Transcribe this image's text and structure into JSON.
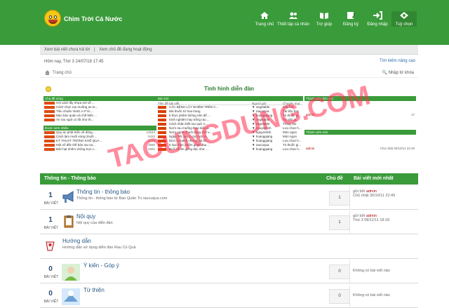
{
  "brand": {
    "title": "Chim Trời Cá Nước"
  },
  "nav": [
    {
      "label": "Trang chủ",
      "icon": "home-icon"
    },
    {
      "label": "Thiết lập cá nhân",
      "icon": "users-icon"
    },
    {
      "label": "Trợ giúp",
      "icon": "book-icon"
    },
    {
      "label": "Đăng ký",
      "icon": "register-icon"
    },
    {
      "label": "Đăng nhập",
      "icon": "login-icon"
    },
    {
      "label": "Tuỳ chọn",
      "icon": "settings-icon"
    }
  ],
  "subbar": {
    "unanswered": "Xem bài viết chưa trả lời",
    "separator": "|",
    "active": "Xem chủ đề đang hoạt động"
  },
  "meta": {
    "date": "Hôm nay, Thứ 3 24/07/18 17:45",
    "advanced_search": "Tìm kiếm nâng cao",
    "home_crumb": "Trang chủ",
    "search_placeholder": "Nhập từ khóa"
  },
  "stats": {
    "title": "Tình hình diễn đàn",
    "recent_topics": {
      "header": "Chủ đề nóng",
      "items": [
        "Hỏi cách lấy nhựa mít về ...",
        "Cách chọn rau muống an to...",
        "Tiêu chuẩn VietG.A.P là ...",
        "Mẹo bảo quản và chế biến ...",
        "Ăn rau ngót có tốt như th..."
      ]
    },
    "viewed": {
      "header": "Được xem nhiều",
      "items": [
        {
          "text": "Quy an phát triển về động ...",
          "num": "13534"
        },
        {
          "text": "Cách làm muối vùng (muối ...",
          "num": "5433"
        },
        {
          "text": "KỸ THUẬT TRỒNG KHỔ QUA ...",
          "num": "3724"
        },
        {
          "text": "Một số đất chế bán rau sa...",
          "num": "3580"
        },
        {
          "text": "Bán hạt nhồm xhông trọn c...",
          "num": "2692"
        }
      ]
    },
    "new_posts": {
      "header": "Bài mới",
      "sub": "Tiêu đề bài viết",
      "items": [
        "CÁC BỆNH LÂY NHIỄM TRÊN C...",
        "Bài thuốc từ hoa trang",
        "6 thực phẩm không nên để ...",
        "Kinh nghiệm hay trồng rau ...",
        "Cách nhận biết rau quả 'o...",
        "Nơm rau muống theo kiểu d...",
        "Nơm ngứa chuối dùng chữ v...",
        "Ngày Tết, lưu ý các món ả...",
        "Dịch vụ bánh chưng, cá kh...",
        "5 loại thực phẩm giảm đau...",
        "Buổi tối ăn gừng độc như ..."
      ]
    },
    "posters": {
      "header": "Người gửi",
      "items": [
        "vegetable",
        "raucuqua",
        "hoanggiang",
        "vegetable",
        "vegetable",
        "nguyenlinh",
        "nguyenlinh",
        "hoanggiang",
        "hoanggiang",
        "raucuqua",
        "hoanggiang"
      ]
    },
    "forums": {
      "header": "Chuyên mục",
      "items": [
        "Cây lúa",
        "Tài liệu hay",
        "Tủ thuốc gi...",
        "Tư vấn gi...",
        "Trồng rau",
        "Lưu chọn h...",
        "Món ngon",
        "Món ngon",
        "Lưu chọn h...",
        "Tủ thuốc gi...",
        "Lưu chọn h..."
      ]
    },
    "active_members": {
      "header": "Thành viên tích cực",
      "name": "admin",
      "count": "17"
    },
    "new_members": {
      "header": "Thành viên mới",
      "name": "admin",
      "date": "Chủ nhật 30/10/11 22:49"
    }
  },
  "watermark": "TAOUNGDUNG.COM",
  "forum": {
    "header": {
      "title": "Thông tin - Thông báo",
      "topics": "Chủ đề",
      "latest": "Bài viết mới nhất"
    },
    "rows": [
      {
        "count": "1",
        "count_label": "BÀI VIẾT",
        "title": "Thông tin - thông báo",
        "desc": "Thông tin - thông báo từ Ban Quản Trị raucuqua.com",
        "topic_count": "1",
        "latest_prefix": "gửi bởi",
        "latest_author": "admin",
        "latest_date": "Chủ nhật 30/10/11 22:49",
        "icon": "megaphone-icon"
      },
      {
        "count": "1",
        "count_label": "BÀI VIẾT",
        "title": "Nội quy",
        "desc": "Nội quy của diễn đàn",
        "topic_count": "1",
        "latest_prefix": "gửi bởi",
        "latest_author": "admin",
        "latest_date": "Thứ 3 08/11/11 18:18",
        "icon": "clipboard-icon"
      },
      {
        "title": "Hướng dẫn",
        "desc": "Hướng dẫn sử dụng diễn đàn Rau Củ Quả",
        "icon": "help-icon"
      },
      {
        "count": "0",
        "count_label": "BÀI VIẾT",
        "title": "Ý kiến - Góp ý",
        "topic_count": "0",
        "empty": "Không có bài viết nào",
        "icon": "feedback-image-icon"
      },
      {
        "count": "0",
        "count_label": "BÀI VIẾT",
        "title": "Từ thiện",
        "topic_count": "0",
        "empty": "Không có bài viết nào",
        "icon": "charity-image-icon"
      }
    ]
  },
  "colors": {
    "green": "#3a9b3a",
    "link": "#2a5a86",
    "red_author": "#b00000",
    "watermark": "#ff2f4f"
  }
}
